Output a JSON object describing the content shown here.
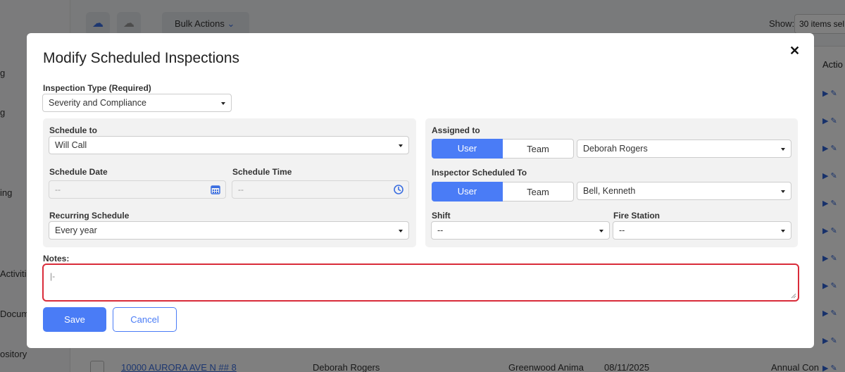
{
  "background": {
    "sidebar_labels": [
      "g",
      "g",
      "ing",
      "Activiti",
      "Docum",
      "ository"
    ],
    "bulk_actions_label": "Bulk Actions",
    "show_label": "Show:",
    "show_value": "30 items sel",
    "actions_header": "Actio",
    "row": {
      "address": "10000 AURORA AVE N ## 8",
      "assignee": "Deborah Rogers",
      "business": "Greenwood Anima",
      "date": "08/11/2025",
      "type": "Annual Con"
    }
  },
  "modal": {
    "title": "Modify Scheduled Inspections",
    "close_glyph": "✕",
    "inspection_type": {
      "label": "Inspection Type (Required)",
      "value": "Severity and Compliance"
    },
    "schedule_to": {
      "label": "Schedule to",
      "value": "Will Call"
    },
    "schedule_date": {
      "label": "Schedule Date",
      "value": "--"
    },
    "schedule_time": {
      "label": "Schedule Time",
      "value": "--"
    },
    "recurring": {
      "label": "Recurring Schedule",
      "value": "Every year"
    },
    "assigned_to": {
      "label": "Assigned to",
      "user_label": "User",
      "team_label": "Team",
      "value": "Deborah Rogers"
    },
    "inspector": {
      "label": "Inspector Scheduled To",
      "user_label": "User",
      "team_label": "Team",
      "value": "Bell, Kenneth"
    },
    "shift": {
      "label": "Shift",
      "value": "--"
    },
    "fire_station": {
      "label": "Fire Station",
      "value": "--"
    },
    "notes": {
      "label": "Notes:",
      "value": ""
    },
    "save_label": "Save",
    "cancel_label": "Cancel"
  },
  "colors": {
    "primary": "#4a7cf6",
    "error_border": "#d92c3a",
    "panel": "#f2f2f2"
  }
}
